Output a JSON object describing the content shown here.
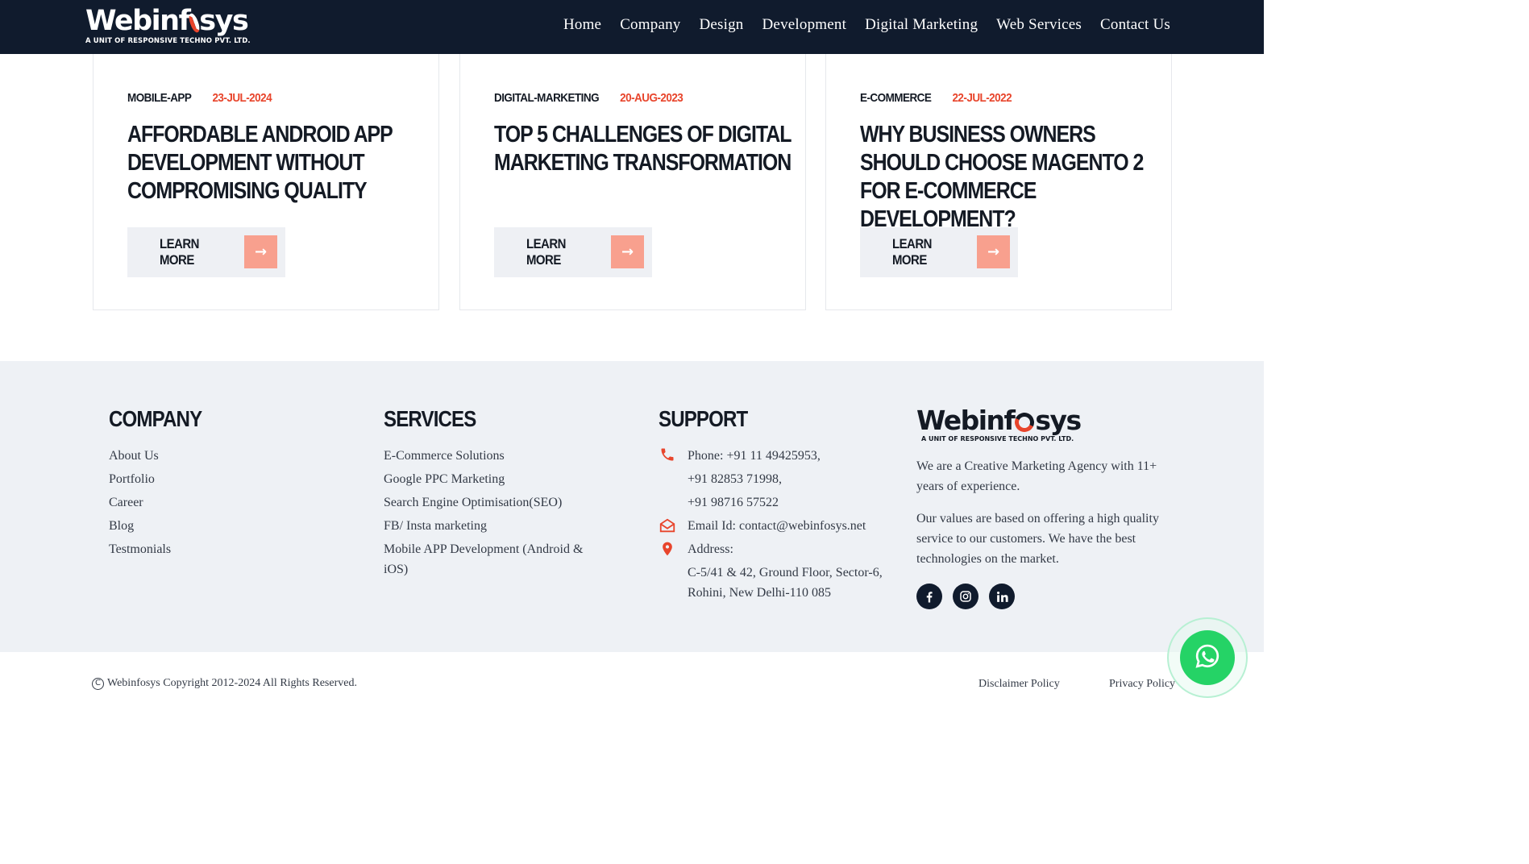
{
  "header": {
    "logo_text_a": "Webinf",
    "logo_text_b": "sys",
    "logo_sub": "A UNIT OF RESPONSIVE TECHNO PVT. LTD.",
    "nav": [
      "Home",
      "Company",
      "Design",
      "Development",
      "Digital Marketing",
      "Web Services",
      "Contact Us"
    ]
  },
  "posts": [
    {
      "category": "MOBILE-APP",
      "date": "23-JUL-2024",
      "title": "AFFORDABLE ANDROID APP DEVELOPMENT WITHOUT COMPROMISING QUALITY",
      "cta": "LEARN MORE"
    },
    {
      "category": "DIGITAL-MARKETING",
      "date": "20-AUG-2023",
      "title": "TOP 5 CHALLENGES OF DIGITAL MARKETING TRANSFORMATION",
      "cta": "LEARN MORE"
    },
    {
      "category": "E-COMMERCE",
      "date": "22-JUL-2022",
      "title": "WHY BUSINESS OWNERS SHOULD CHOOSE MAGENTO 2 FOR E-COMMERCE DEVELOPMENT?",
      "cta": "LEARN MORE"
    }
  ],
  "footer": {
    "company": {
      "heading": "COMPANY",
      "links": [
        "About Us",
        "Portfolio",
        "Career",
        "Blog",
        "Testmonials"
      ]
    },
    "services": {
      "heading": "SERVICES",
      "links": [
        "E-Commerce Solutions",
        "Google PPC Marketing",
        "Search Engine Optimisation(SEO)",
        "FB/ Insta marketing",
        "Mobile APP Development (Android & iOS)"
      ]
    },
    "support": {
      "heading": "SUPPORT",
      "phone_1": "Phone: +91 11 49425953,",
      "phone_2": "+91 82853 71998,",
      "phone_3": "+91 98716 57522",
      "email": "Email Id: contact@webinfosys.net",
      "address_label": "Address:",
      "address": "C-5/41 & 42, Ground Floor, Sector-6, Rohini, New Delhi-110 085"
    },
    "about": {
      "logo_text_a": "Webinf",
      "logo_text_b": "sys",
      "logo_sub": "A UNIT OF RESPONSIVE TECHNO PVT. LTD.",
      "p1": "We are a Creative Marketing Agency with 11+ years of experience.",
      "p2": "Our values are based on offering a high quality service to our customers. We have the best technologies on the market.",
      "social_icons": [
        "facebook-icon",
        "instagram-icon",
        "linkedin-icon"
      ]
    }
  },
  "bottom": {
    "copyright": "Webinfosys Copyright 2012-2024 All Rights Reserved.",
    "disclaimer": "Disclaimer Policy",
    "privacy": "Privacy Policy"
  },
  "colors": {
    "navy": "#101b2d",
    "accent": "#e8452c",
    "arrow_bg": "#f8a08e",
    "footer_bg": "#eef1f5",
    "whatsapp": "#25d366"
  }
}
